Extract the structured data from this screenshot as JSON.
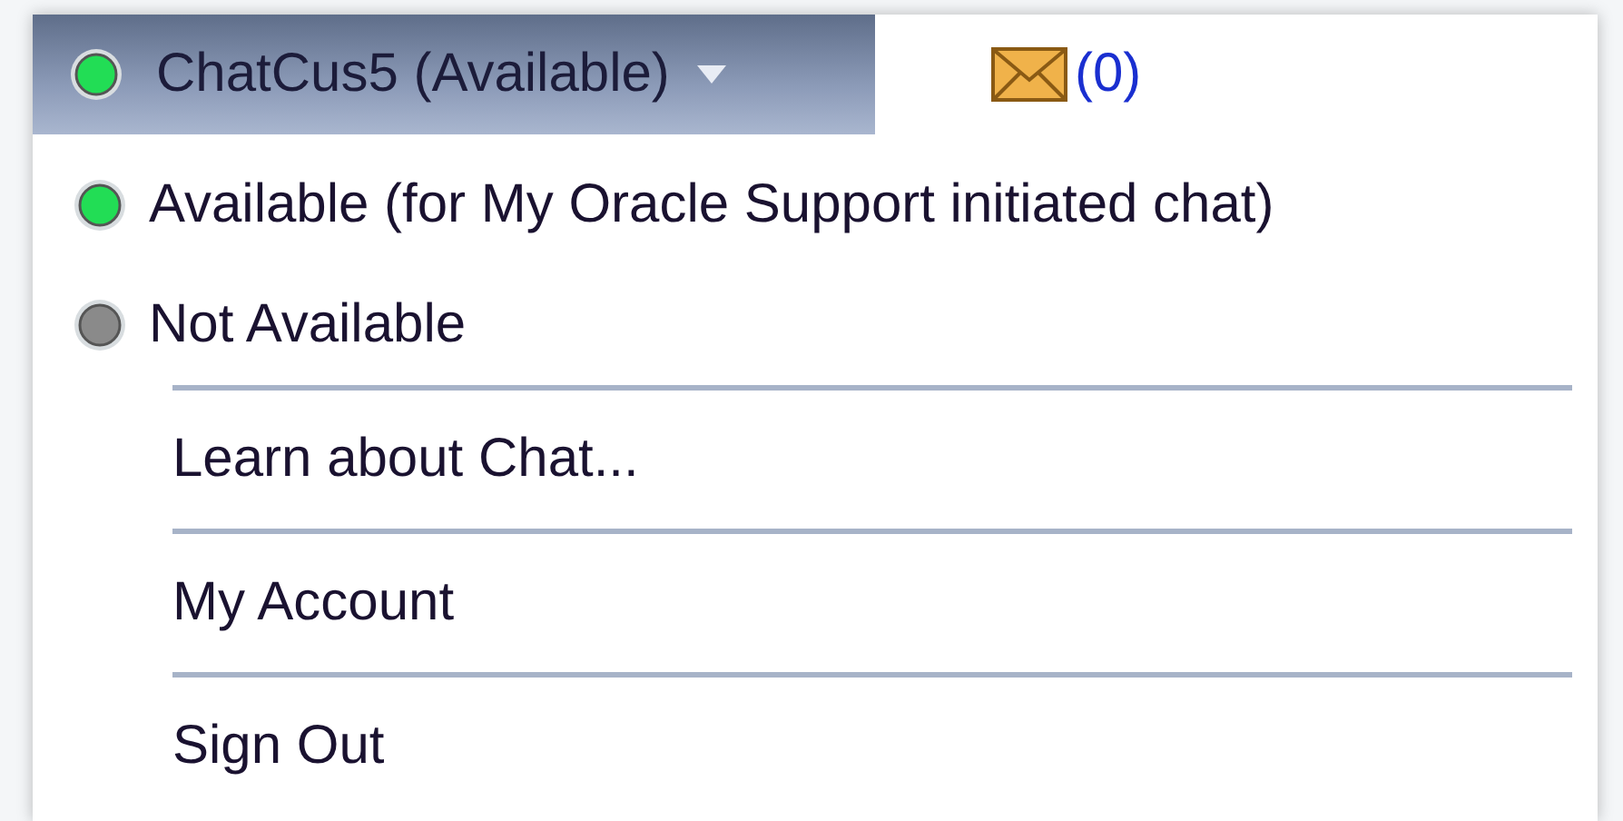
{
  "status_button": {
    "label": "ChatCus5 (Available)",
    "color": "#22dd55"
  },
  "messages": {
    "count": "(0)"
  },
  "menu": [
    {
      "kind": "status",
      "label": "Available (for My Oracle Support initiated chat)",
      "color": "#22dd55"
    },
    {
      "kind": "status",
      "label": "Not Available",
      "color": "#8a8a8a"
    },
    {
      "kind": "link",
      "label": "Learn about Chat..."
    },
    {
      "kind": "link",
      "label": "My Account"
    },
    {
      "kind": "link",
      "label": "Sign Out"
    }
  ]
}
